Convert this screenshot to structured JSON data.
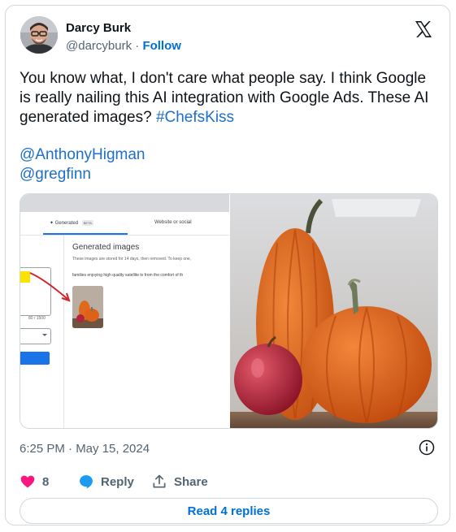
{
  "author": {
    "name": "Darcy Burk",
    "handle": "@darcyburk",
    "separator": "·",
    "follow_label": "Follow"
  },
  "platform_icon": "x-logo-icon",
  "tweet": {
    "text": "You know what, I don't care what people say. I think Google is really nailing this AI integration with Google Ads. These AI generated images?",
    "hashtag": "#ChefsKiss",
    "mentions": [
      "@AnthonyHigman",
      "@gregfinn"
    ]
  },
  "media": {
    "screenshot": {
      "tab_generated": "Generated",
      "tab_beta": "BETA",
      "tab_website": "Website or social",
      "generated_title": "Generated images",
      "generated_note": "These images are stored for 14 days, then removed. To keep one,",
      "prompt_text": "families enjoying high quality satellite tv from the comfort of th",
      "char_count": "80 / 1500"
    },
    "photo_subject": "pumpkins-and-apple"
  },
  "timestamp": "6:25 PM · May 15, 2024",
  "actions": {
    "like_count": "8",
    "reply_label": "Reply",
    "share_label": "Share"
  },
  "read_replies_label": "Read 4 replies",
  "colors": {
    "link": "#1d6fc7",
    "follow": "#006fd6",
    "heart": "#f91880",
    "reply_bubble": "#1d9bf0",
    "muted": "#536471"
  }
}
